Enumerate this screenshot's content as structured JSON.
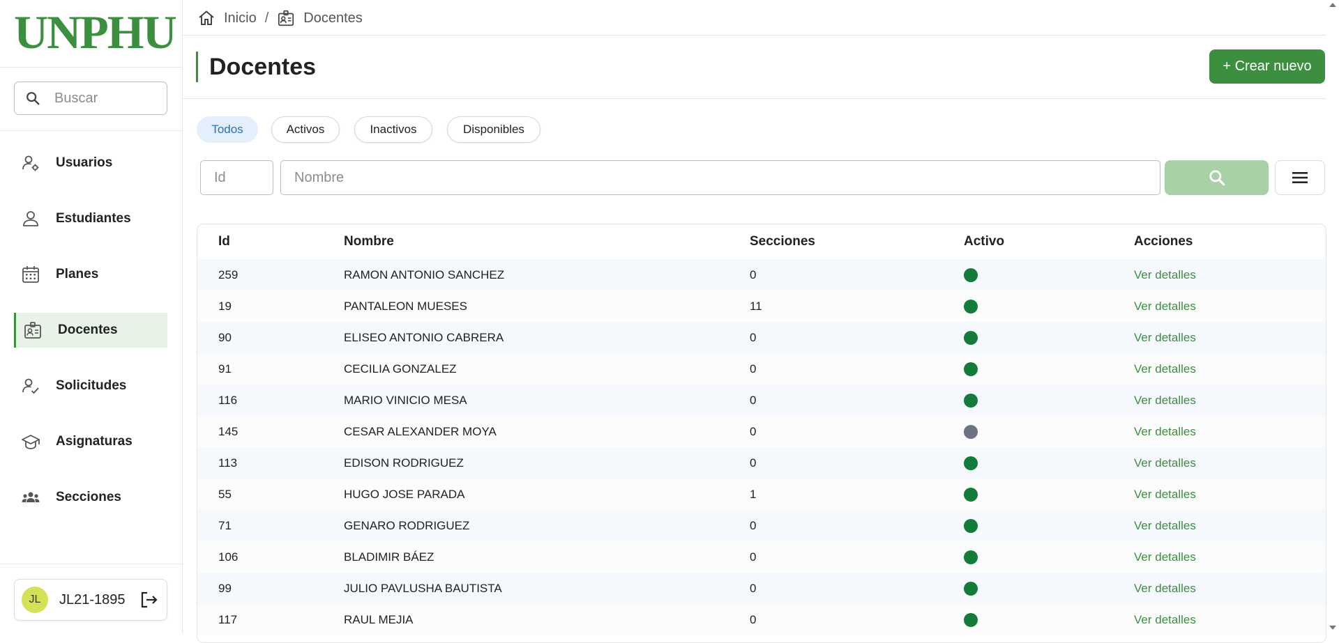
{
  "brand": {
    "logo_text": "UNPHU"
  },
  "sidebar": {
    "search_placeholder": "Buscar",
    "items": [
      {
        "label": "Usuarios",
        "icon": "user-gear-icon",
        "active": false
      },
      {
        "label": "Estudiantes",
        "icon": "person-icon",
        "active": false
      },
      {
        "label": "Planes",
        "icon": "calendar-icon",
        "active": false
      },
      {
        "label": "Docentes",
        "icon": "id-badge-icon",
        "active": true
      },
      {
        "label": "Solicitudes",
        "icon": "person-check-icon",
        "active": false
      },
      {
        "label": "Asignaturas",
        "icon": "graduation-cap-icon",
        "active": false
      },
      {
        "label": "Secciones",
        "icon": "group-icon",
        "active": false
      }
    ],
    "user": {
      "initials": "JL",
      "name": "JL21-1895"
    }
  },
  "breadcrumb": {
    "home": "Inicio",
    "separator": "/",
    "current": "Docentes"
  },
  "page": {
    "title": "Docentes",
    "create_label": "+ Crear nuevo"
  },
  "filters": {
    "chips": [
      "Todos",
      "Activos",
      "Inactivos",
      "Disponibles"
    ],
    "active_chip": "Todos",
    "id_placeholder": "Id",
    "name_placeholder": "Nombre"
  },
  "table": {
    "columns": [
      "Id",
      "Nombre",
      "Secciones",
      "Activo",
      "Acciones"
    ],
    "action_label": "Ver detalles",
    "rows": [
      {
        "id": "259",
        "nombre": "RAMON ANTONIO SANCHEZ",
        "secciones": "0",
        "activo": true
      },
      {
        "id": "19",
        "nombre": "PANTALEON MUESES",
        "secciones": "11",
        "activo": true
      },
      {
        "id": "90",
        "nombre": "ELISEO ANTONIO CABRERA",
        "secciones": "0",
        "activo": true
      },
      {
        "id": "91",
        "nombre": "CECILIA GONZALEZ",
        "secciones": "0",
        "activo": true
      },
      {
        "id": "116",
        "nombre": "MARIO VINICIO MESA",
        "secciones": "0",
        "activo": true
      },
      {
        "id": "145",
        "nombre": "CESAR ALEXANDER MOYA",
        "secciones": "0",
        "activo": false
      },
      {
        "id": "113",
        "nombre": "EDISON RODRIGUEZ",
        "secciones": "0",
        "activo": true
      },
      {
        "id": "55",
        "nombre": "HUGO JOSE PARADA",
        "secciones": "1",
        "activo": true
      },
      {
        "id": "71",
        "nombre": "GENARO RODRIGUEZ",
        "secciones": "0",
        "activo": true
      },
      {
        "id": "106",
        "nombre": "BLADIMIR BÁEZ",
        "secciones": "0",
        "activo": true
      },
      {
        "id": "99",
        "nombre": "JULIO PAVLUSHA BAUTISTA",
        "secciones": "0",
        "activo": true
      },
      {
        "id": "117",
        "nombre": "RAUL MEJIA",
        "secciones": "0",
        "activo": true
      }
    ]
  },
  "colors": {
    "brand_green": "#3b8f3e",
    "active_dot": "#137c3a",
    "inactive_dot": "#6b7280",
    "search_button": "#a8d1a8",
    "active_chip_bg": "#e3f0fb",
    "active_chip_text": "#2f6fb0"
  }
}
